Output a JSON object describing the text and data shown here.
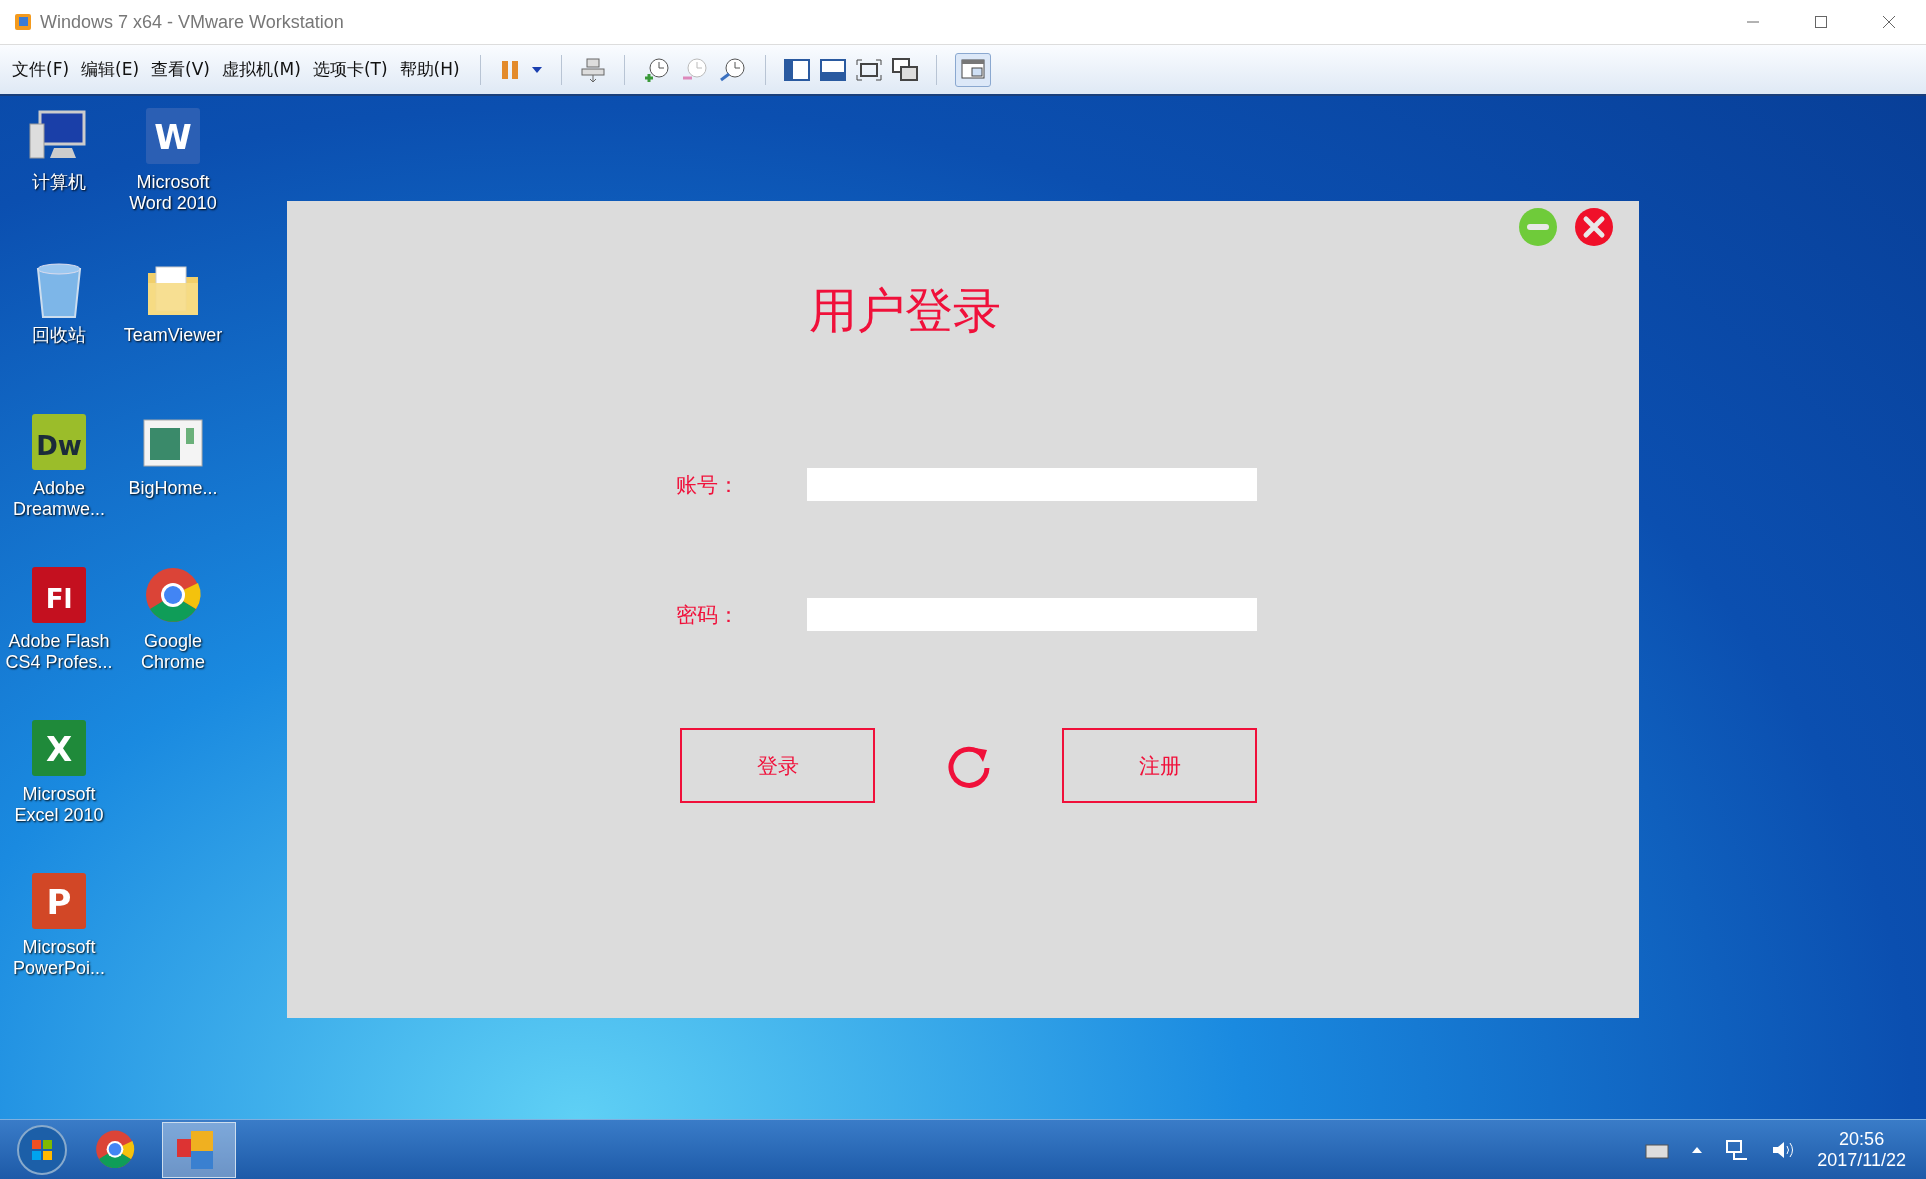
{
  "window": {
    "title": "Windows 7 x64 - VMware Workstation"
  },
  "menu": [
    "文件(F)",
    "编辑(E)",
    "查看(V)",
    "虚拟机(M)",
    "选项卡(T)",
    "帮助(H)"
  ],
  "desktop_icons": [
    {
      "label": "计算机"
    },
    {
      "label": "回收站"
    },
    {
      "label": "Adobe Dreamwe...",
      "icon_letter": "Dw"
    },
    {
      "label": "Adobe Flash CS4 Profes...",
      "icon_letter": "Fl"
    },
    {
      "label": "Microsoft Excel 2010",
      "icon_letter": "X"
    },
    {
      "label": "Microsoft PowerPoi...",
      "icon_letter": "P"
    },
    {
      "label": "Microsoft Word 2010",
      "icon_letter": "W"
    },
    {
      "label": "TeamViewer"
    },
    {
      "label": "BigHome..."
    },
    {
      "label": "Google Chrome"
    }
  ],
  "login": {
    "title": "用户登录",
    "fields": [
      {
        "label": "账号："
      },
      {
        "label": "密码："
      }
    ],
    "buttons": [
      "登录",
      "注册"
    ]
  },
  "taskbar": {
    "time": "20:56",
    "date": "2017/11/22"
  }
}
